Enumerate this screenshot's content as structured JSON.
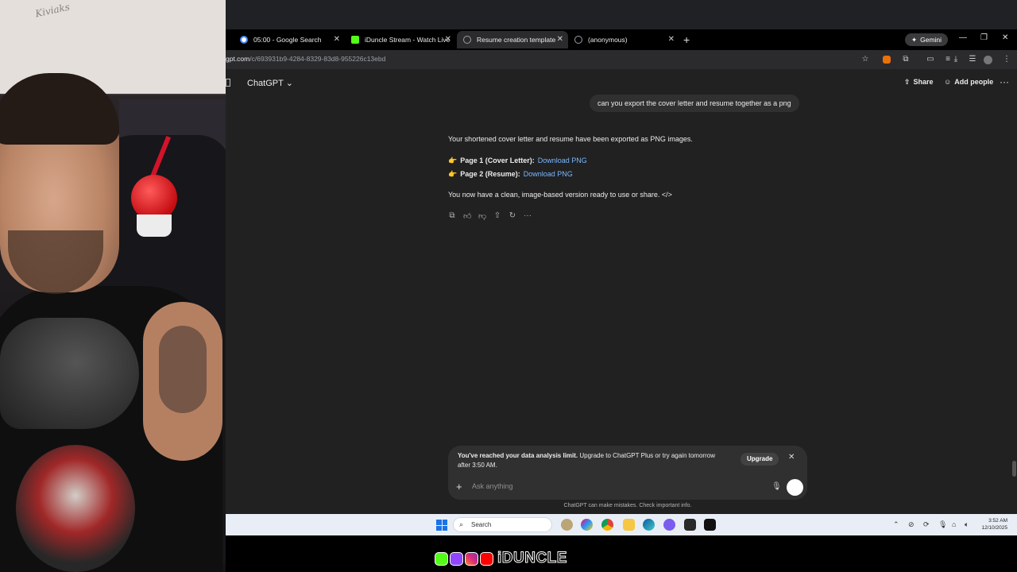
{
  "webcam": {
    "wall_writing": "Kiviaks"
  },
  "tabs": [
    {
      "title": "05:00 - Google Search",
      "color": "#4285f4"
    },
    {
      "title": "iDuncle Stream - Watch Live on",
      "color": "#53fc18"
    },
    {
      "title": "Resume creation template",
      "color": "#9aa0a6",
      "active": true
    },
    {
      "title": "(anonymous)",
      "color": "#9aa0a6"
    }
  ],
  "browser": {
    "gemini_label": "Gemini",
    "url_host": "gpt.com",
    "url_path": "/c/693931b9-4284-8329-83d8-955226c13ebd"
  },
  "chat": {
    "model_name": "ChatGPT",
    "share_label": "Share",
    "add_people_label": "Add people",
    "user_message": "can you export the cover letter and resume together as a png",
    "assistant": {
      "intro": "Your shortened cover letter and resume have been exported as PNG images.",
      "page1_label": "Page 1 (Cover Letter):",
      "page1_link": "Download PNG",
      "page2_label": "Page 2 (Resume):",
      "page2_link": "Download PNG",
      "outro": "You now have a clean, image-based version ready to use or share."
    },
    "limit_notice": {
      "bold": "You've reached your data analysis limit.",
      "rest": " Upgrade to ChatGPT Plus or try again tomorrow after 3:50 AM.",
      "upgrade_label": "Upgrade"
    },
    "input_placeholder": "Ask anything",
    "disclaimer": "ChatGPT can make mistakes. Check important info."
  },
  "taskbar": {
    "search_label": "Search",
    "time": "3:52 AM",
    "date": "12/10/2025"
  },
  "brand": {
    "name": "iDUNCLE"
  },
  "colors": {
    "accent_link": "#7ab7ff",
    "app_bg": "#212121",
    "taskbar_bg": "#e9eef6"
  }
}
